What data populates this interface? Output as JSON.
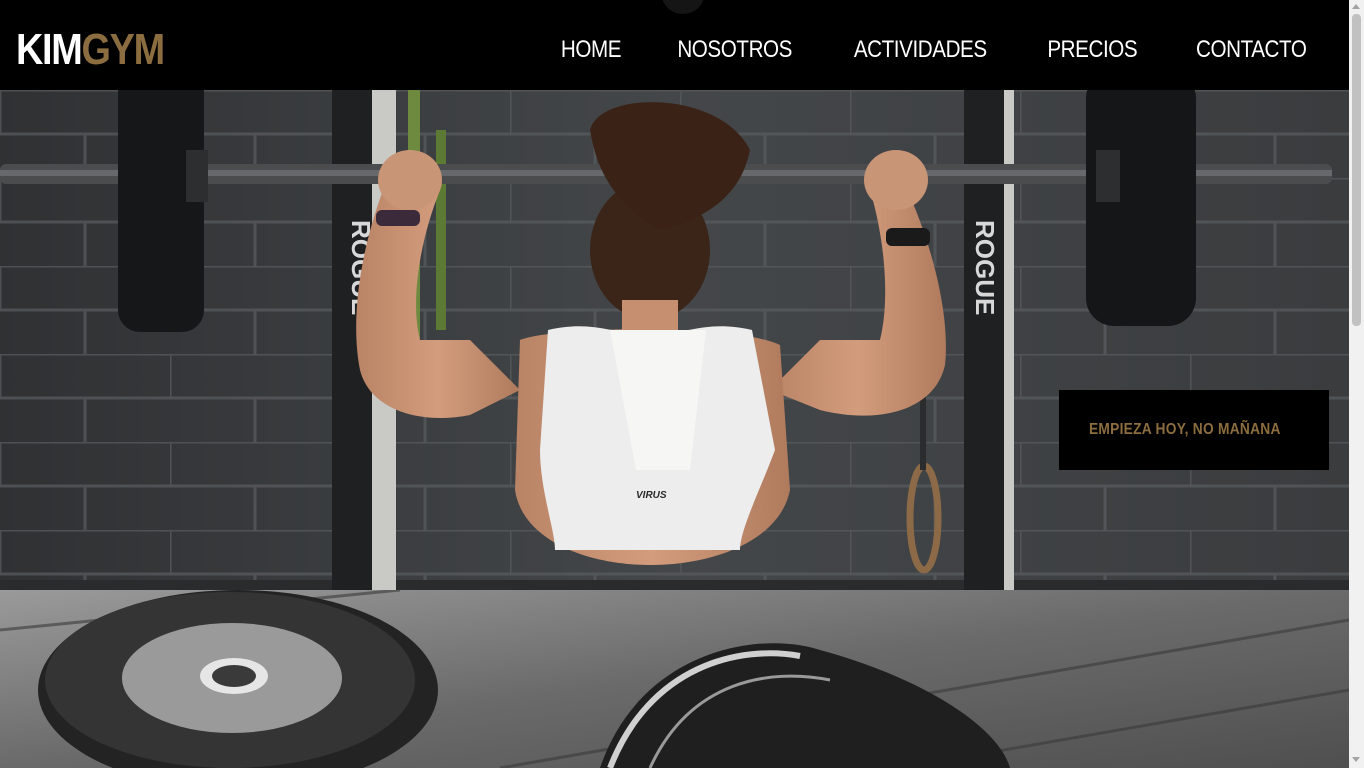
{
  "header": {
    "logo": {
      "part1": "KIM",
      "part2": "GYM"
    },
    "nav": [
      {
        "label": "HOME"
      },
      {
        "label": "NOSOTROS"
      },
      {
        "label": "ACTIVIDADES"
      },
      {
        "label": "PRECIOS"
      },
      {
        "label": "CONTACTO"
      }
    ]
  },
  "hero": {
    "cta": "EMPIEZA HOY, NO MAÑANA",
    "shirt_text": "VIRUS",
    "rig_text": "ROGUE"
  },
  "colors": {
    "accent": "#8b6d3f",
    "header_bg": "#000000",
    "nav_text": "#ffffff"
  }
}
